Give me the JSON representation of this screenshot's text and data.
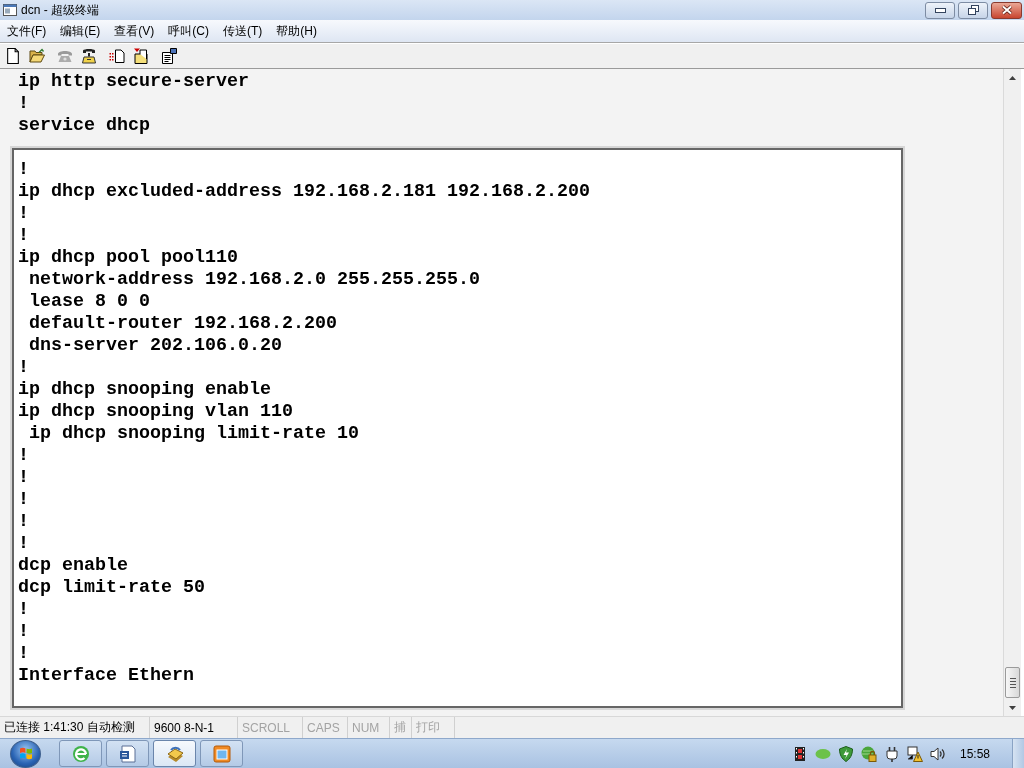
{
  "window": {
    "title": "dcn - 超级终端"
  },
  "menu": [
    "文件(F)",
    "编辑(E)",
    "查看(V)",
    "呼叫(C)",
    "传送(T)",
    "帮助(H)"
  ],
  "toolbar": {
    "groups": [
      {
        "buttons": [
          {
            "kind": "new",
            "disabled": false
          },
          {
            "kind": "open",
            "disabled": false
          }
        ]
      },
      {
        "buttons": [
          {
            "kind": "call",
            "disabled": true
          },
          {
            "kind": "hangup",
            "disabled": false
          }
        ]
      },
      {
        "buttons": [
          {
            "kind": "send",
            "disabled": false
          },
          {
            "kind": "receive",
            "disabled": false
          }
        ]
      },
      {
        "buttons": [
          {
            "kind": "properties",
            "disabled": false
          }
        ]
      }
    ]
  },
  "terminal": {
    "lines": [
      {
        "text": "ip http secure-server"
      },
      {
        "text": "!"
      },
      {
        "text": "service dhcp"
      }
    ],
    "panel": {
      "lines": [
        {
          "text": "!"
        },
        {
          "text": "ip dhcp excluded-address 192.168.2.181 192.168.2.200"
        },
        {
          "text": "!"
        },
        {
          "text": "!"
        },
        {
          "text": "ip dhcp pool pool110",
          "children": [
            {
              "text": "network-address 192.168.2.0 255.255.255.0"
            },
            {
              "text": "lease 8 0 0"
            },
            {
              "text": "default-router 192.168.2.200"
            },
            {
              "text": "dns-server 202.106.0.20"
            }
          ]
        },
        {
          "text": "!"
        },
        {
          "text": "ip dhcp snooping enable"
        },
        {
          "text": "ip dhcp snooping vlan 110",
          "children": [
            {
              "text": "ip dhcp snooping limit-rate 10"
            }
          ]
        },
        {
          "text": "!"
        },
        {
          "text": "!"
        },
        {
          "text": "!"
        },
        {
          "text": "!"
        },
        {
          "text": "!"
        },
        {
          "text": "dcp enable"
        },
        {
          "text": "dcp limit-rate 50"
        },
        {
          "text": "!"
        },
        {
          "text": "!"
        },
        {
          "text": "!"
        },
        {
          "text": "Interface Ethern"
        }
      ]
    }
  },
  "status_bar": {
    "panes": [
      {
        "text": "已连接 1:41:30 自动检测",
        "disabled": false
      },
      {
        "text": "9600 8-N-1",
        "disabled": false
      },
      {
        "text": "SCROLL",
        "disabled": true
      },
      {
        "text": "CAPS",
        "disabled": true
      },
      {
        "text": "NUM",
        "disabled": true
      },
      {
        "text": "捕",
        "disabled": true
      },
      {
        "text": "打印",
        "disabled": true
      }
    ]
  },
  "taskbar": {
    "buttons": [
      {
        "kind": "browser",
        "selected": false
      },
      {
        "kind": "document",
        "selected": false
      },
      {
        "kind": "terminal",
        "selected": true
      },
      {
        "kind": "window",
        "selected": false
      }
    ],
    "clock": "15:58"
  }
}
